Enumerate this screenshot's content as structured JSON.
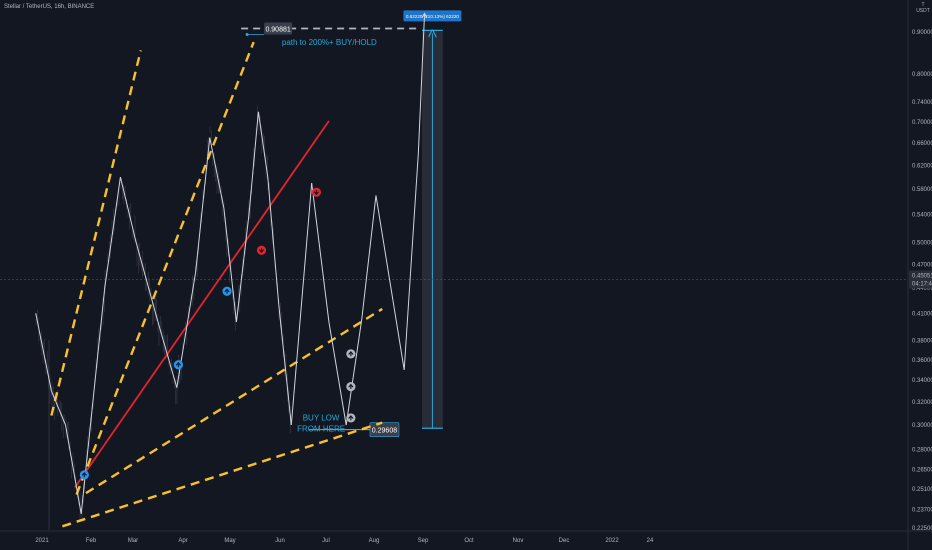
{
  "header": {
    "symbol_title": "Stellar / TetherUS, 16h, BINANCE",
    "currency_top": "T",
    "currency_unit": "USDT"
  },
  "chart_data": {
    "type": "line",
    "title": "Stellar / TetherUS, 16h, BINANCE",
    "xlabel": "",
    "ylabel": "",
    "yscale": "log",
    "ylim": [
      0.215,
      1.02
    ],
    "grid": false,
    "x_ticks": [
      "2021",
      "Feb",
      "Mar",
      "Apr",
      "May",
      "Jun",
      "Jul",
      "Aug",
      "Sep",
      "Oct",
      "Nov",
      "Dec",
      "2022",
      "24"
    ],
    "y_ticks": [
      "0.90000",
      "0.80000",
      "0.74000",
      "0.70000",
      "0.66000",
      "0.62000",
      "0.58000",
      "0.54000",
      "0.50000",
      "0.47000",
      "0.44000",
      "0.41000",
      "0.38000",
      "0.36000",
      "0.34000",
      "0.32000",
      "0.30000",
      "0.28000",
      "0.26500",
      "0.25100",
      "0.23700",
      "0.22500"
    ],
    "current_price": {
      "price": "0.45051",
      "countdown": "04:17:42"
    },
    "series": [
      {
        "id": "price-path",
        "color": "#d1d4dc",
        "points": [
          [
            "2020-12-28",
            0.41
          ],
          [
            "2021-01-07",
            0.33
          ],
          [
            "2021-01-16",
            0.3
          ],
          [
            "2021-01-26",
            0.234
          ],
          [
            "2021-02-10",
            0.44
          ],
          [
            "2021-02-20",
            0.6
          ],
          [
            "2021-03-02",
            0.5
          ],
          [
            "2021-03-16",
            0.4
          ],
          [
            "2021-03-28",
            0.333
          ],
          [
            "2021-04-09",
            0.46
          ],
          [
            "2021-04-18",
            0.67
          ],
          [
            "2021-04-27",
            0.55
          ],
          [
            "2021-05-05",
            0.4
          ],
          [
            "2021-05-13",
            0.54
          ],
          [
            "2021-05-19",
            0.72
          ],
          [
            "2021-05-25",
            0.6
          ],
          [
            "2021-06-01",
            0.42
          ],
          [
            "2021-06-09",
            0.3
          ],
          [
            "2021-06-22",
            0.59
          ],
          [
            "2021-07-03",
            0.4
          ],
          [
            "2021-07-14",
            0.3
          ],
          [
            "2021-07-24",
            0.404
          ],
          [
            "2021-08-02",
            0.57
          ],
          [
            "2021-08-20",
            0.35
          ],
          [
            "2021-08-29",
            0.64
          ],
          [
            "2021-09-02",
            0.948
          ]
        ]
      }
    ],
    "trendlines": [
      {
        "id": "red-trendline",
        "color": "#e0252f",
        "style": "solid",
        "from": [
          "2021-01-22",
          0.252
        ],
        "to": [
          "2021-07-03",
          0.702
        ]
      },
      {
        "id": "yellow-channel-1",
        "color": "#f7c12d",
        "style": "dashed",
        "from": [
          "2021-01-07",
          0.308
        ],
        "to": [
          "2021-03-05",
          0.855
        ]
      },
      {
        "id": "yellow-channel-2",
        "color": "#f7c12d",
        "style": "dashed",
        "from": [
          "2021-01-23",
          0.247
        ],
        "to": [
          "2021-05-16",
          0.875
        ]
      },
      {
        "id": "yellow-channel-3",
        "color": "#f7c12d",
        "style": "dashed",
        "from": [
          "2021-01-29",
          0.248
        ],
        "to": [
          "2021-08-06",
          0.415
        ]
      },
      {
        "id": "yellow-channel-4",
        "color": "#f7c12d",
        "style": "dashed",
        "from": [
          "2021-01-14",
          0.226
        ],
        "to": [
          "2021-08-06",
          0.302
        ]
      }
    ],
    "levels": [
      {
        "id": "target-level",
        "value": 0.90881,
        "label": "0.90881",
        "color": "#b2b5be",
        "style": "dashed",
        "from": "2021-05-08",
        "to": "2021-08-29"
      },
      {
        "id": "buy-level",
        "value": 0.29608,
        "label": "0.29608",
        "color": "#b2b5be",
        "style": "solid",
        "from": "2021-06-20",
        "to": "2021-08-02"
      }
    ],
    "projection": {
      "id": "price-range-projection",
      "from_date": "2021-09-01",
      "to_date": "2021-09-13",
      "low": 0.2973,
      "high": 0.9041,
      "label": "0.62220 (210.13%) 62220",
      "color": "#2aa6d8"
    },
    "annotations": [
      {
        "id": "path-note",
        "text": "path to 200%+ BUY/HOLD",
        "date": "2021-06-03",
        "value": 0.868,
        "color": "#2aa6d8"
      },
      {
        "id": "buy-low-note",
        "lines": [
          "BUY LOW",
          "FROM HERE"
        ],
        "date": "2021-06-28",
        "value": 0.304,
        "color": "#2aa6d8"
      }
    ],
    "markers": [
      {
        "id": "buy-marker-1",
        "kind": "up",
        "color": "#2196f3",
        "date": "2021-01-28",
        "value": 0.261
      },
      {
        "id": "buy-marker-2",
        "kind": "up",
        "color": "#2196f3",
        "date": "2021-03-29",
        "value": 0.355
      },
      {
        "id": "buy-marker-3",
        "kind": "up",
        "color": "#2196f3",
        "date": "2021-04-29",
        "value": 0.436
      },
      {
        "id": "sell-marker-1",
        "kind": "down",
        "color": "#e0252f",
        "date": "2021-05-21",
        "value": 0.489
      },
      {
        "id": "sell-marker-2",
        "kind": "down",
        "color": "#e0252f",
        "date": "2021-06-25",
        "value": 0.575
      },
      {
        "id": "buy-marker-4",
        "kind": "up",
        "color": "#b2b5be",
        "date": "2021-07-17",
        "value": 0.366
      },
      {
        "id": "buy-marker-5",
        "kind": "up",
        "color": "#b2b5be",
        "date": "2021-07-17",
        "value": 0.334
      },
      {
        "id": "buy-marker-6",
        "kind": "up",
        "color": "#b2b5be",
        "date": "2021-07-17",
        "value": 0.306
      }
    ]
  }
}
